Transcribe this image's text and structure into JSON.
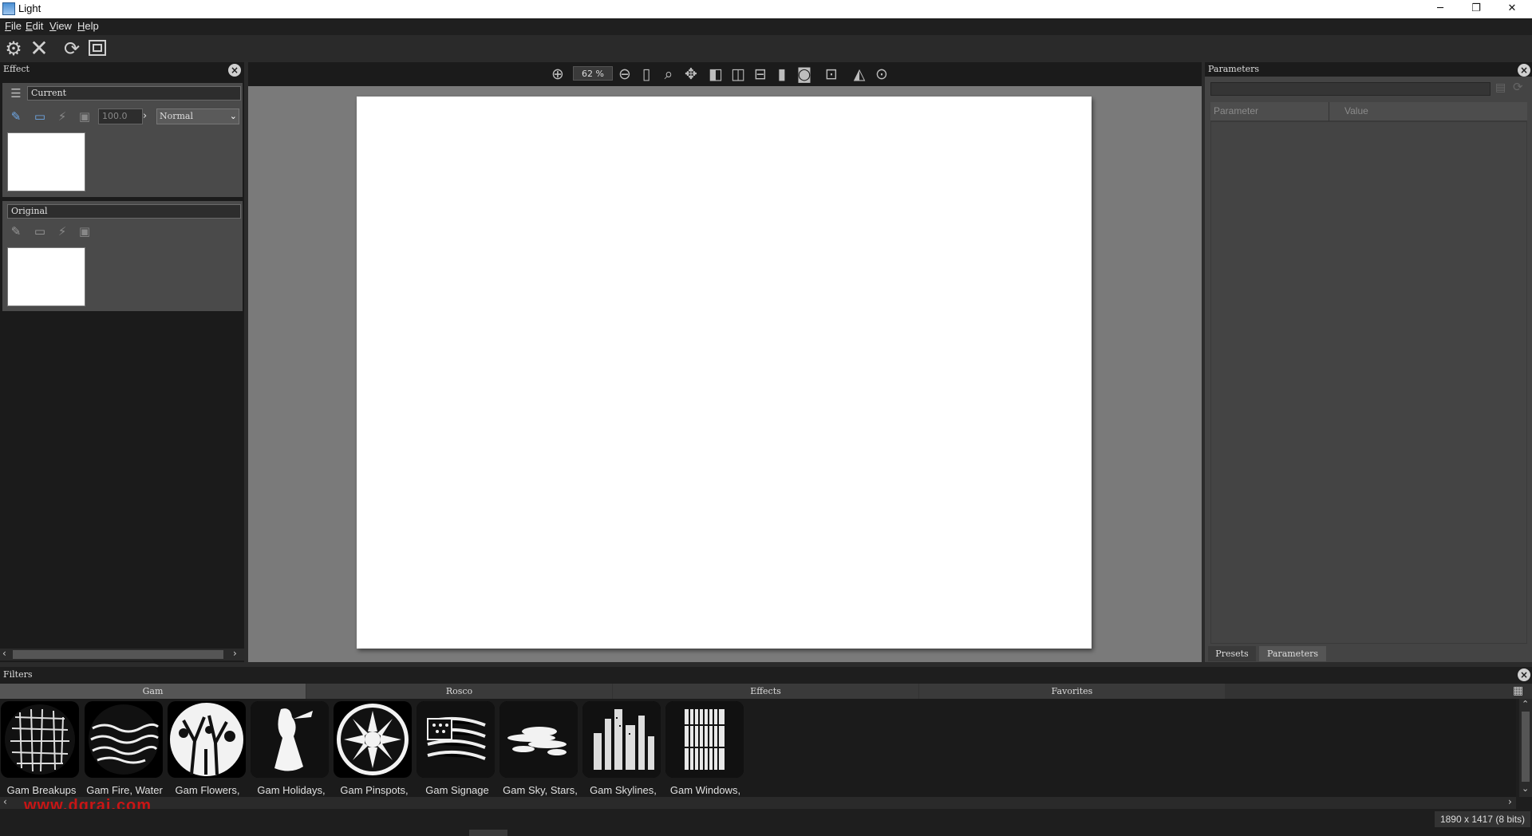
{
  "window": {
    "title": "Light",
    "minimize": "─",
    "maximize": "❐",
    "close": "✕"
  },
  "menu": [
    "File",
    "Edit",
    "View",
    "Help"
  ],
  "toolbar": {
    "icons": [
      "gear-icon",
      "close-x-icon",
      "refresh-icon",
      "fit-frame-icon"
    ]
  },
  "effect_panel": {
    "title": "Effect",
    "current": {
      "name": "Current",
      "opacity": "100.0",
      "blend_mode": "Normal"
    },
    "original": {
      "name": "Original"
    }
  },
  "canvas": {
    "zoom": "62 %"
  },
  "parameters_panel": {
    "title": "Parameters",
    "columns": [
      "Parameter",
      "Value"
    ],
    "tabs": [
      "Presets",
      "Parameters"
    ]
  },
  "filters_panel": {
    "title": "Filters",
    "tabs": [
      "Gam",
      "Rosco",
      "Effects",
      "Favorites"
    ],
    "items": [
      "Gam Breakups",
      "Gam Fire, Water",
      "Gam Flowers,",
      "Gam Holidays,",
      "Gam Pinspots,",
      "Gam Signage",
      "Gam Sky, Stars,",
      "Gam Skylines,",
      "Gam Windows,"
    ]
  },
  "status": {
    "image_info": "1890 x 1417 (8 bits)"
  },
  "watermark": "www.dgrai.com",
  "colors": {
    "background": "#2b2b2b",
    "canvas_bg": "#7a7a7a",
    "panel_dark": "#1b1b1b",
    "watermark": "#c81515"
  }
}
